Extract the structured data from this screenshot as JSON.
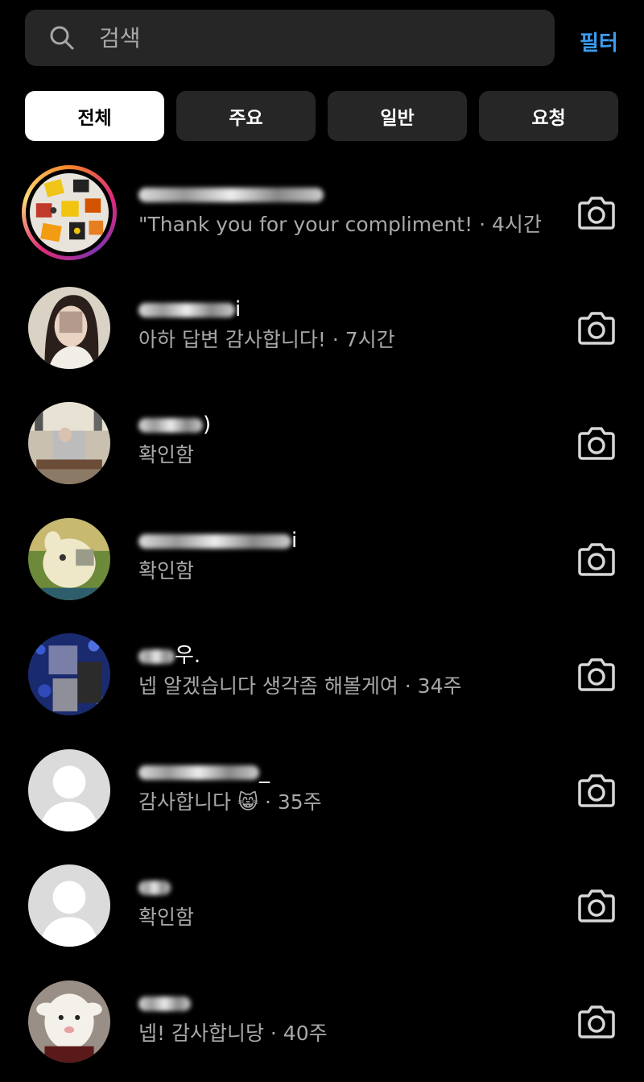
{
  "search": {
    "placeholder": "검색"
  },
  "header": {
    "filter_label": "필터"
  },
  "tabs": [
    {
      "label": "전체",
      "active": true
    },
    {
      "label": "주요",
      "active": false
    },
    {
      "label": "일반",
      "active": false
    },
    {
      "label": "요청",
      "active": false
    }
  ],
  "threads": [
    {
      "name_visible": "",
      "preview": "\"Thank you for your compliment! · 4시간",
      "avatar": "toys-photo",
      "story_ring": true
    },
    {
      "name_visible": "i",
      "preview": "아하 답변 감사합니다! · 7시간",
      "avatar": "girl-photo",
      "story_ring": false
    },
    {
      "name_visible": ")",
      "preview": "확인함",
      "avatar": "room-photo",
      "story_ring": false
    },
    {
      "name_visible": "i",
      "preview": "확인함",
      "avatar": "cartoon-photo",
      "story_ring": false
    },
    {
      "name_visible": "우.",
      "preview": "넵 알겠습니다 생각좀 해볼게여 · 34주",
      "avatar": "blue-pattern-photo",
      "story_ring": false
    },
    {
      "name_visible": "_",
      "preview": "감사합니다 😸 · 35주",
      "avatar": "default-user",
      "story_ring": false
    },
    {
      "name_visible": "",
      "preview": "확인함",
      "avatar": "default-user",
      "story_ring": false
    },
    {
      "name_visible": "",
      "preview": "넵! 감사합니당 · 40주",
      "avatar": "animal-photo",
      "story_ring": false
    }
  ],
  "colors": {
    "accent": "#3b9cf0",
    "background": "#000000",
    "surface": "#262626",
    "secondary_text": "#a8a8a8"
  },
  "icons": {
    "search": "search-icon",
    "camera": "camera-icon"
  }
}
